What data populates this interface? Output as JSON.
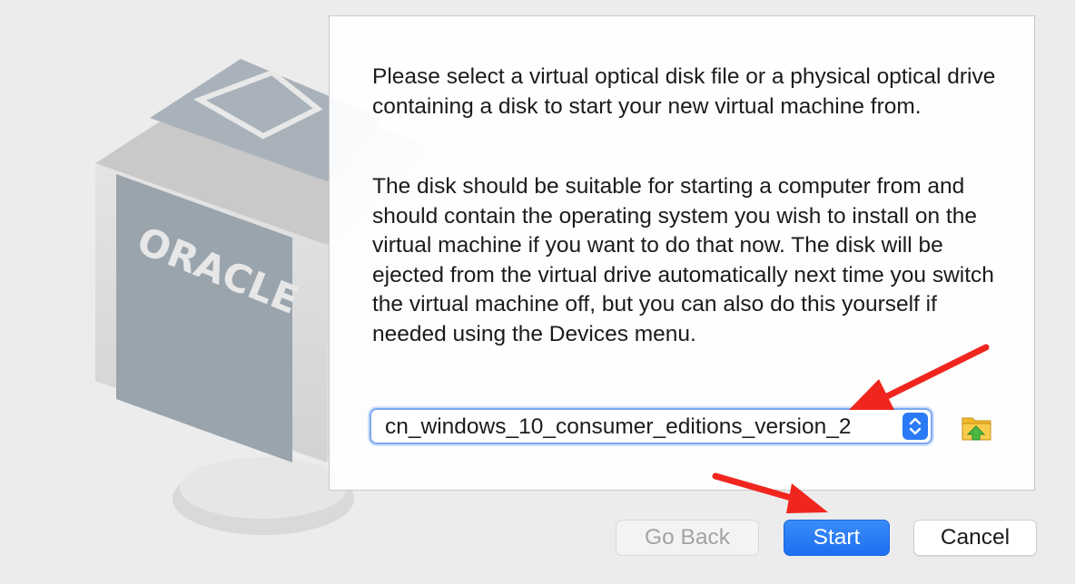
{
  "dialog": {
    "paragraph_1": "Please select a virtual optical disk file or a physical optical drive containing a disk to start your new virtual machine from.",
    "paragraph_2": "The disk should be suitable for starting a computer from and should contain the operating system you wish to install on the virtual machine if you want to do that now. The disk will be ejected from the virtual drive automatically next time you switch the virtual machine off, but you can also do this yourself if needed using the Devices menu.",
    "disk_select_value": "cn_windows_10_consumer_editions_version_2"
  },
  "watermark": {
    "logo_text": "ORACLE"
  },
  "buttons": {
    "go_back": "Go Back",
    "start": "Start",
    "cancel": "Cancel"
  },
  "icons": {
    "stepper": "up-down-chevron-icon",
    "folder": "folder-with-green-arrow-icon"
  },
  "colors": {
    "accent": "#1e6ff2",
    "annotation_arrow": "#f0261e",
    "panel_bg": "#ffffff",
    "window_bg": "#ececec"
  }
}
